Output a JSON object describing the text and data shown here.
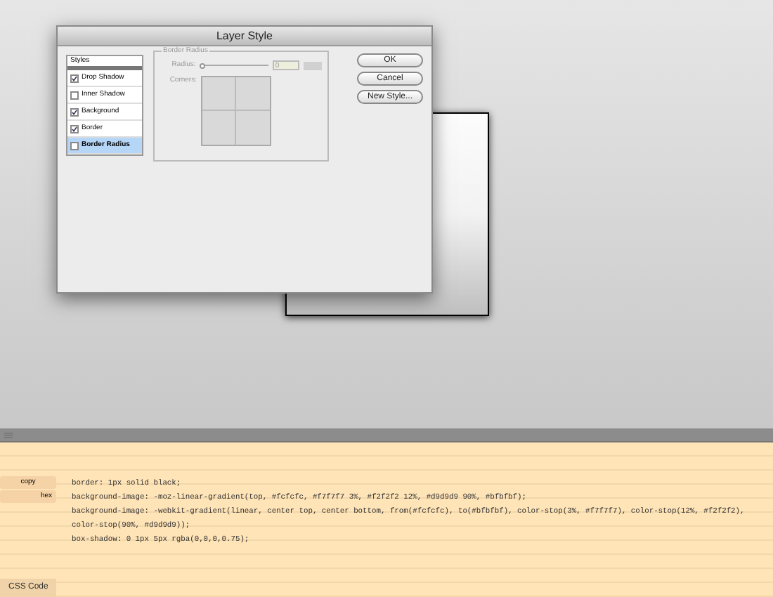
{
  "dialog": {
    "title": "Layer Style",
    "styles_header": "Styles",
    "styles": [
      {
        "label": "Drop Shadow",
        "checked": true,
        "selected": false
      },
      {
        "label": "Inner Shadow",
        "checked": false,
        "selected": false
      },
      {
        "label": "Background",
        "checked": true,
        "selected": false
      },
      {
        "label": "Border",
        "checked": true,
        "selected": false
      },
      {
        "label": "Border Radius",
        "checked": false,
        "selected": true
      }
    ],
    "group_title": "Border Radius",
    "radius_label": "Radius:",
    "radius": {
      "level": 0,
      "value": "0"
    },
    "corners_label": "Corners:",
    "buttons": [
      "OK",
      "Cancel",
      "New Style..."
    ]
  },
  "code_panel": {
    "tools": [
      "copy",
      "hex"
    ],
    "lines": [
      "border: 1px solid black;",
      "background-image: -moz-linear-gradient(top, #fcfcfc, #f7f7f7 3%, #f2f2f2 12%, #d9d9d9 90%, #bfbfbf);",
      "background-image: -webkit-gradient(linear, center top, center bottom, from(#fcfcfc), to(#bfbfbf), color-stop(3%, #f7f7f7), color-stop(12%, #f2f2f2),",
      "color-stop(90%, #d9d9d9));",
      "box-shadow: 0 1px 5px rgba(0,0,0,0.75);"
    ],
    "tab": "CSS Code"
  }
}
